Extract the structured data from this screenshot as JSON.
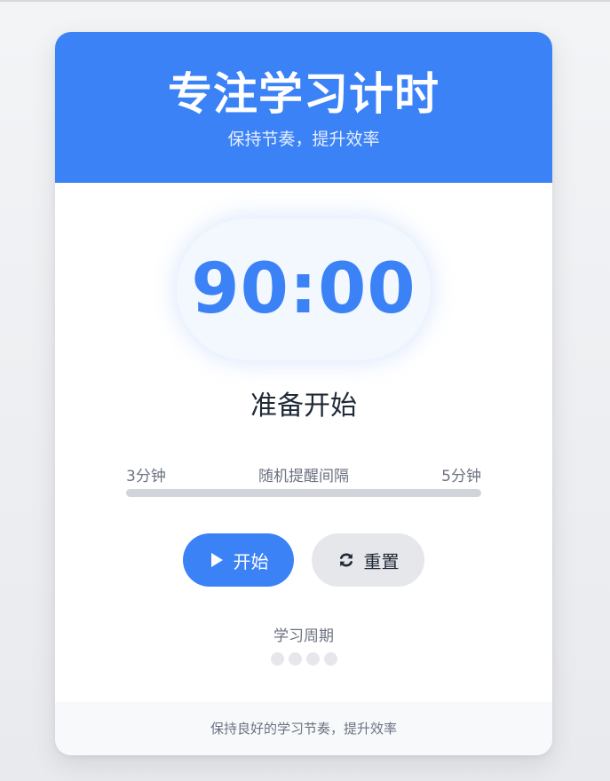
{
  "header": {
    "title": "专注学习计时",
    "subtitle": "保持节奏，提升效率"
  },
  "timer": {
    "display": "90:00",
    "status": "准备开始"
  },
  "reminder": {
    "min_label": "3分钟",
    "label": "随机提醒间隔",
    "max_label": "5分钟"
  },
  "controls": {
    "start_label": "开始",
    "start_icon": "play-icon",
    "reset_label": "重置",
    "reset_icon": "refresh-icon"
  },
  "cycles": {
    "label": "学习周期",
    "count": 4,
    "completed": 0
  },
  "footer": {
    "text": "保持良好的学习节奏，提升效率"
  },
  "colors": {
    "accent": "#3b82f6",
    "inactive": "#e5e7eb",
    "text_dark": "#1f2937",
    "text_muted": "#6b7280"
  }
}
